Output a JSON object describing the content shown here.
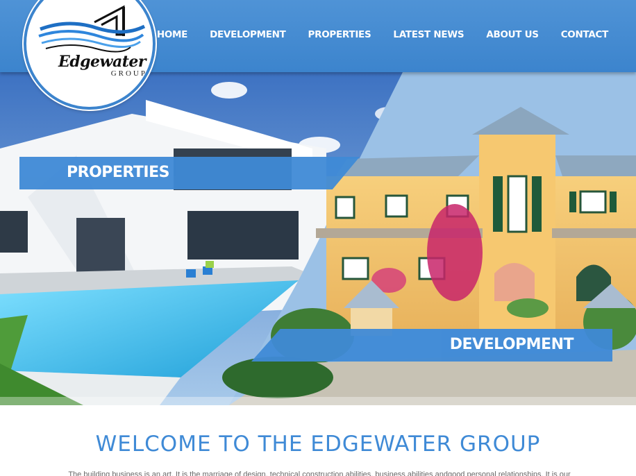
{
  "brand": {
    "name": "Edgewater",
    "sub": "GROUP"
  },
  "nav": {
    "items": [
      "HOME",
      "DEVELOPMENT",
      "PROPERTIES",
      "LATEST NEWS",
      "ABOUT US",
      "CONTACT"
    ]
  },
  "hero": {
    "left_banner": "PROPERTIES",
    "right_banner": "DEVELOPMENT"
  },
  "welcome": {
    "title": "WELCOME TO THE EDGEWATER GROUP",
    "text": "The building business is an art. It is the marriage of design, technical construction abilities, business abilities andgood personal relationships. It is our"
  },
  "colors": {
    "header": "#3c84cd",
    "accent": "#3f8ad6"
  }
}
